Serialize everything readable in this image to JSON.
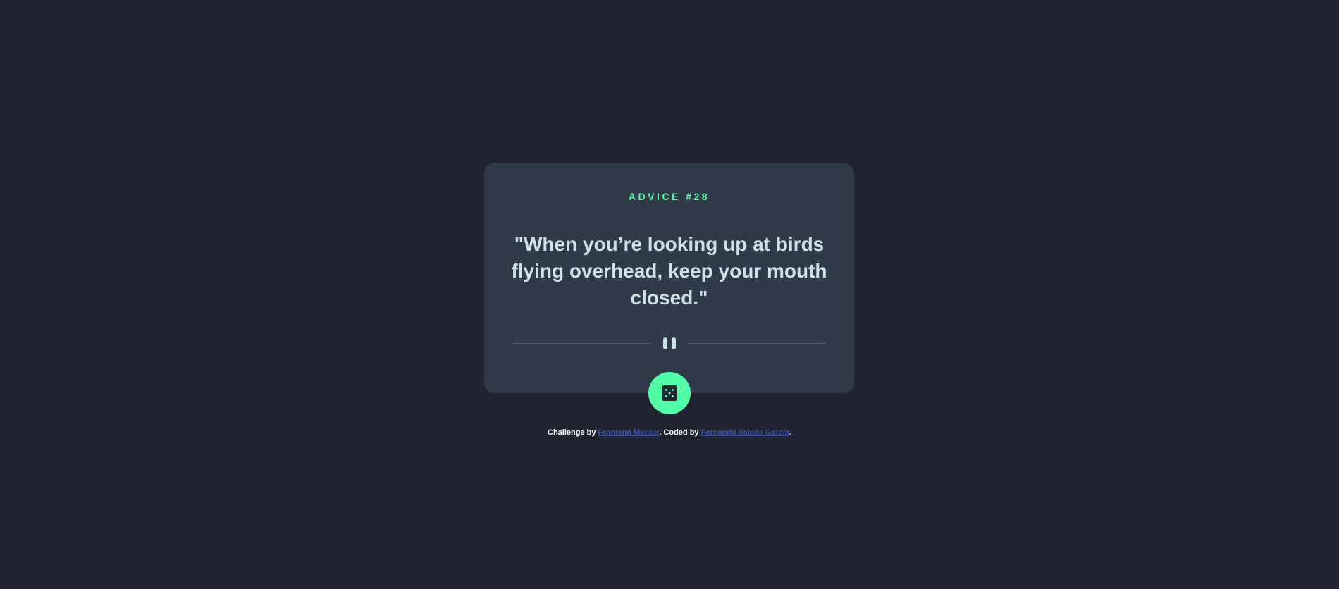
{
  "card": {
    "advice_label": "ADVICE #28",
    "quote": "\"When you’re looking up at birds flying overhead, keep your mouth closed.\""
  },
  "icons": {
    "divider": "pause-icon",
    "button": "dice-icon"
  },
  "attribution": {
    "prefix": "Challenge by ",
    "challenge_link": "Frontend Mentor",
    "middle": ". Coded by ",
    "author_link": "Fernando Valdés García",
    "suffix": "."
  },
  "colors": {
    "background": "#1f2430",
    "card": "#313a48",
    "accent": "#52ffa8",
    "text": "#cee3e9",
    "link": "#3e52a3"
  }
}
